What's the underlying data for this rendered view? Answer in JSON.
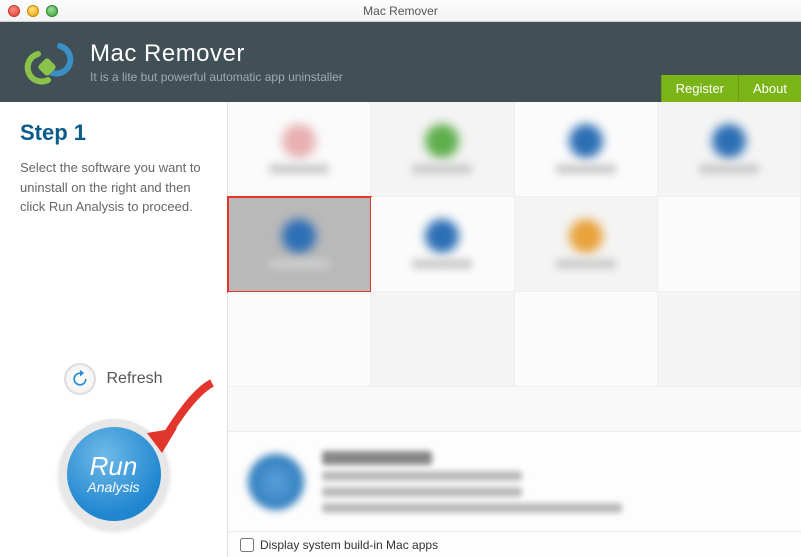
{
  "window": {
    "title": "Mac Remover"
  },
  "header": {
    "title": "Mac Remover",
    "subtitle": "It is a lite but powerful automatic app uninstaller",
    "register_label": "Register",
    "about_label": "About"
  },
  "sidebar": {
    "step_title": "Step 1",
    "step_desc": "Select the software you want to uninstall on the right and then click Run Analysis to proceed.",
    "refresh_label": "Refresh",
    "run_top": "Run",
    "run_bottom": "Analysis"
  },
  "grid": {
    "selected_index": 4,
    "items": [
      {
        "icon_color": "#e8b0b0"
      },
      {
        "icon_color": "#5fae4d"
      },
      {
        "icon_color": "#2d6fb5"
      },
      {
        "icon_color": "#2d6fb5"
      },
      {
        "icon_color": "#2d6fb5"
      },
      {
        "icon_color": "#2d6fb5"
      },
      {
        "icon_color": "#e8a33b"
      },
      {
        "icon_color": ""
      },
      {
        "icon_color": ""
      },
      {
        "icon_color": ""
      },
      {
        "icon_color": ""
      },
      {
        "icon_color": ""
      }
    ]
  },
  "footer": {
    "display_system_apps_label": "Display system build-in Mac apps",
    "display_system_apps_checked": false
  },
  "colors": {
    "accent": "#7bb417",
    "header_bg": "#414f56",
    "step_title": "#0a5a8a",
    "run_btn": "#2a8ed4",
    "selection_outline": "#e2352c",
    "arrow": "#e2352c"
  }
}
